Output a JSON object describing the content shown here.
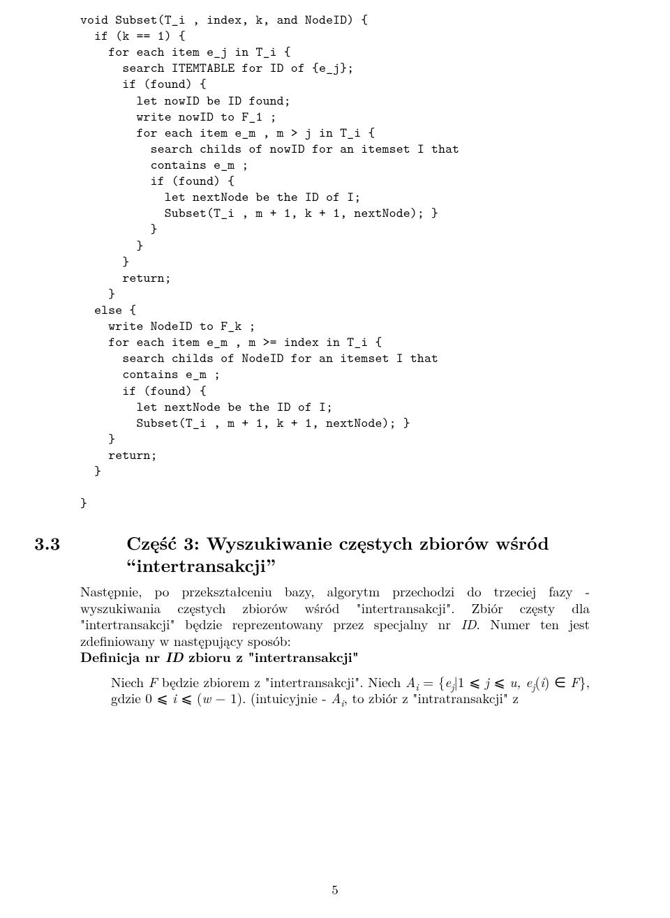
{
  "code": "void Subset(T_i , index, k, and NodeID) {\n  if (k == 1) {\n    for each item e_j in T_i {\n      search ITEMTABLE for ID of {e_j};\n      if (found) {\n        let nowID be ID found;\n        write nowID to F_1 ;\n        for each item e_m , m > j in T_i {\n          search childs of nowID for an itemset I that\n          contains e_m ;\n          if (found) {\n            let nextNode be the ID of I;\n            Subset(T_i , m + 1, k + 1, nextNode); }\n          }\n        }\n      }\n      return;\n    }\n  else {\n    write NodeID to F_k ;\n    for each item e_m , m >= index in T_i {\n      search childs of NodeID for an itemset I that\n      contains e_m ;\n      if (found) {\n        let nextNode be the ID of I;\n        Subset(T_i , m + 1, k + 1, nextNode); }\n    }\n    return;\n  }\n\n}",
  "section": {
    "number": "3.3",
    "title_line": "Część 3: Wyszukiwanie częstych zbiorów wśród \"intertransakcji\""
  },
  "para1": "Następnie, po przekształceniu bazy, algorytm przechodzi do trzeciej fazy - wyszukiwania częstych zbiorów wśród \"intertransakcji\". Zbiór częsty dla \"intertransakcji\" będzie reprezentowany przez specjalny nr ",
  "para1_idpart": "ID",
  "para1_mid": ". Numer ten jest zdefiniowany w następujący sposób:",
  "defn_prefix": "Definicja nr ",
  "defn_id": "ID",
  "defn_suffix": " zbioru z \"intertransakcji\"",
  "quote_a": "Niech ",
  "quote_F": "F",
  "quote_b": " będzie zbiorem z \"intertransakcji\". Niech ",
  "quote_Ai": "A",
  "quote_i": "i",
  "quote_eq": " = {",
  "quote_ej": "e",
  "quote_j": "j",
  "quote_bar": "|1 ⩽ ",
  "quote_jv": "j",
  "quote_leu": " ⩽ ",
  "quote_u": "u, e",
  "quote_j2": "j",
  "quote_pi": "(",
  "quote_iv": "i",
  "quote_close": ") ∈ ",
  "quote_F2": "F",
  "quote_g": "}, gdzie 0 ⩽ ",
  "quote_iv2": "i",
  "quote_lew": " ⩽ (",
  "quote_w": "w",
  "quote_m1": " − 1). (intuicyjnie - ",
  "quote_Ai2": "A",
  "quote_i2": "i",
  "quote_tail": ", to zbiór z \"intratransakcji\" z",
  "pagenum": "5"
}
